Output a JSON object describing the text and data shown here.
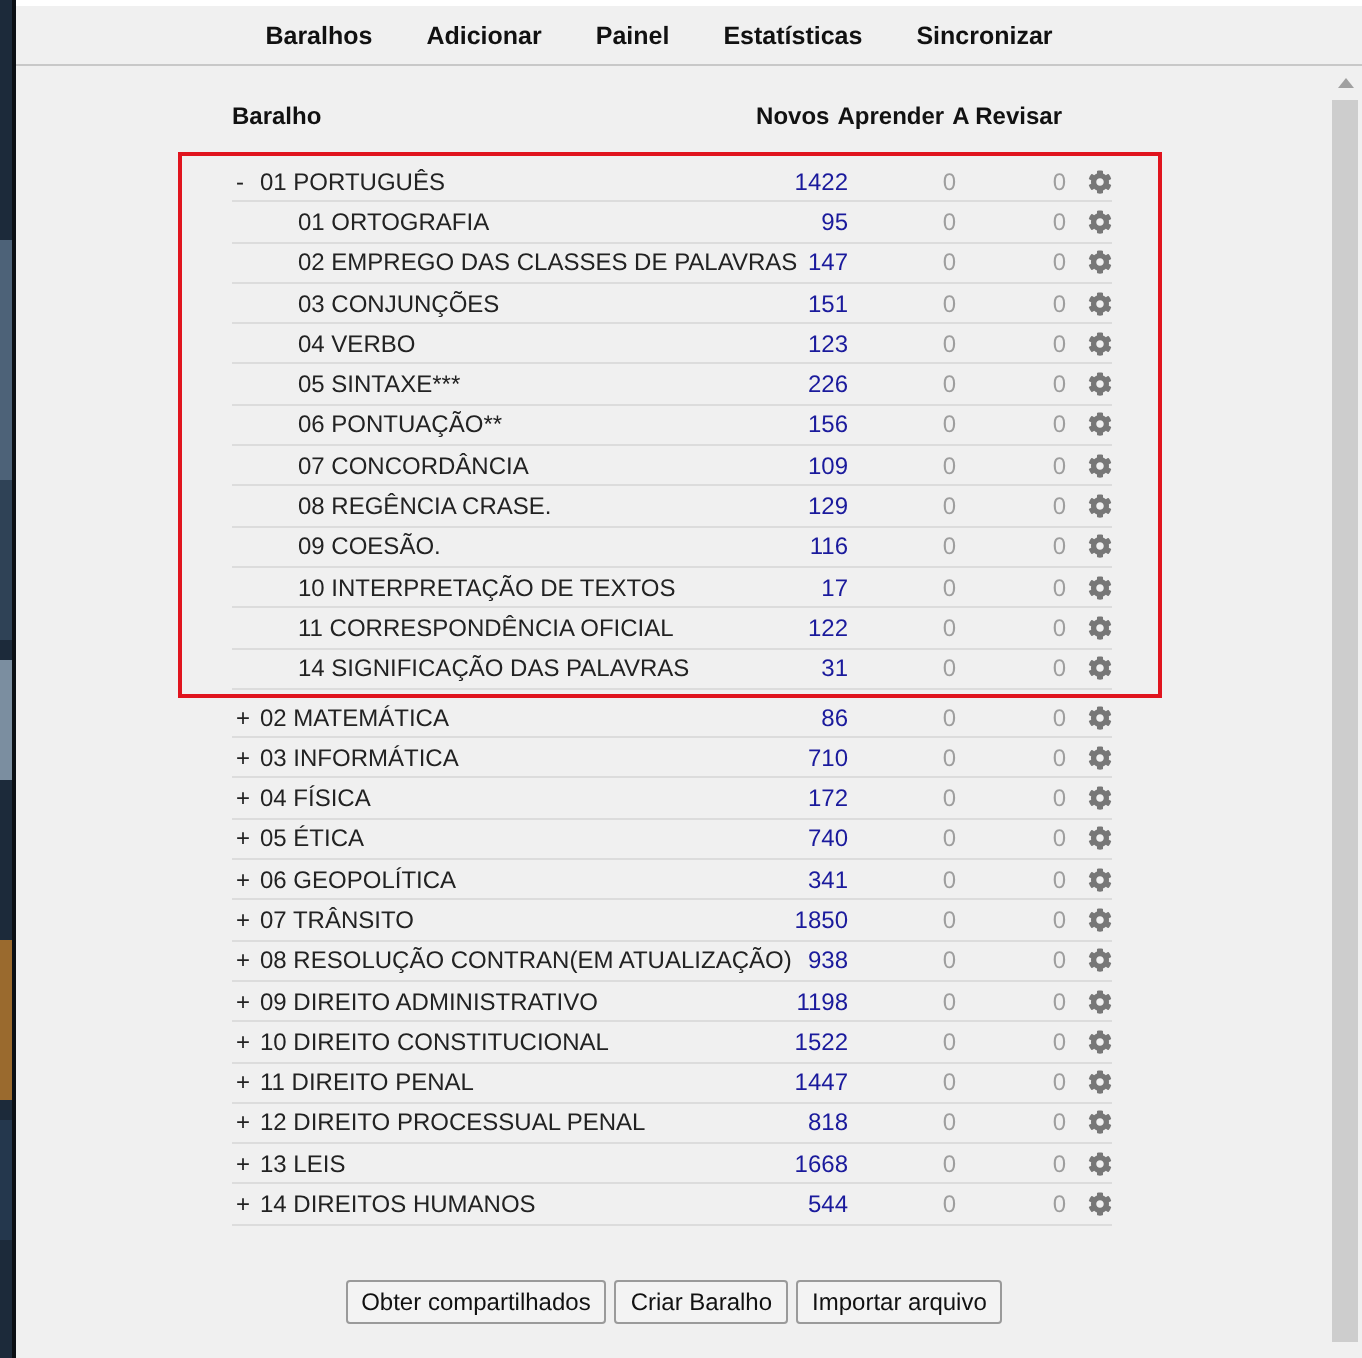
{
  "toolbar": [
    "Baralhos",
    "Adicionar",
    "Painel",
    "Estatísticas",
    "Sincronizar"
  ],
  "columns": {
    "deck": "Baralho",
    "new": "Novos",
    "learn": "Aprender",
    "due": "A Revisar"
  },
  "decks": [
    {
      "toggle": "-",
      "name": "01 PORTUGUÊS",
      "new": "1422",
      "learn": "0",
      "due": "0",
      "highlighted": true,
      "children": [
        {
          "name": "01 ORTOGRAFIA",
          "new": "95",
          "learn": "0",
          "due": "0"
        },
        {
          "name": "02 EMPREGO DAS CLASSES DE PALAVRAS",
          "new": "147",
          "learn": "0",
          "due": "0"
        },
        {
          "name": "03 CONJUNÇÕES",
          "new": "151",
          "learn": "0",
          "due": "0"
        },
        {
          "name": "04 VERBO",
          "new": "123",
          "learn": "0",
          "due": "0"
        },
        {
          "name": "05 SINTAXE***",
          "new": "226",
          "learn": "0",
          "due": "0"
        },
        {
          "name": "06 PONTUAÇÃO**",
          "new": "156",
          "learn": "0",
          "due": "0"
        },
        {
          "name": "07 CONCORDÂNCIA",
          "new": "109",
          "learn": "0",
          "due": "0"
        },
        {
          "name": "08 REGÊNCIA CRASE.",
          "new": "129",
          "learn": "0",
          "due": "0"
        },
        {
          "name": "09 COESÃO.",
          "new": "116",
          "learn": "0",
          "due": "0"
        },
        {
          "name": "10 INTERPRETAÇÃO DE TEXTOS",
          "new": "17",
          "learn": "0",
          "due": "0"
        },
        {
          "name": "11 CORRESPONDÊNCIA OFICIAL",
          "new": "122",
          "learn": "0",
          "due": "0"
        },
        {
          "name": "14 SIGNIFICAÇÃO DAS PALAVRAS",
          "new": "31",
          "learn": "0",
          "due": "0"
        }
      ]
    },
    {
      "toggle": "+",
      "name": "02 MATEMÁTICA",
      "new": "86",
      "learn": "0",
      "due": "0",
      "highlighted": false
    },
    {
      "toggle": "+",
      "name": "03 INFORMÁTICA",
      "new": "710",
      "learn": "0",
      "due": "0",
      "highlighted": false
    },
    {
      "toggle": "+",
      "name": "04 FÍSICA",
      "new": "172",
      "learn": "0",
      "due": "0",
      "highlighted": false
    },
    {
      "toggle": "+",
      "name": "05 ÉTICA",
      "new": "740",
      "learn": "0",
      "due": "0",
      "highlighted": false
    },
    {
      "toggle": "+",
      "name": "06 GEOPOLÍTICA",
      "new": "341",
      "learn": "0",
      "due": "0",
      "highlighted": false
    },
    {
      "toggle": "+",
      "name": "07 TRÂNSITO",
      "new": "1850",
      "learn": "0",
      "due": "0",
      "highlighted": false
    },
    {
      "toggle": "+",
      "name": "08 RESOLUÇÃO CONTRAN(EM ATUALIZAÇÃO)",
      "new": "938",
      "learn": "0",
      "due": "0",
      "highlighted": false
    },
    {
      "toggle": "+",
      "name": "09 DIREITO ADMINISTRATIVO",
      "new": "1198",
      "learn": "0",
      "due": "0",
      "highlighted": false
    },
    {
      "toggle": "+",
      "name": "10 DIREITO CONSTITUCIONAL",
      "new": "1522",
      "learn": "0",
      "due": "0",
      "highlighted": false
    },
    {
      "toggle": "+",
      "name": "11 DIREITO PENAL",
      "new": "1447",
      "learn": "0",
      "due": "0",
      "highlighted": false
    },
    {
      "toggle": "+",
      "name": "12 DIREITO PROCESSUAL PENAL",
      "new": "818",
      "learn": "0",
      "due": "0",
      "highlighted": false
    },
    {
      "toggle": "+",
      "name": "13 LEIS",
      "new": "1668",
      "learn": "0",
      "due": "0",
      "highlighted": false
    },
    {
      "toggle": "+",
      "name": "14 DIREITOS HUMANOS",
      "new": "544",
      "learn": "0",
      "due": "0",
      "highlighted": false
    }
  ],
  "buttons": [
    "Obter compartilhados",
    "Criar Baralho",
    "Importar arquivo"
  ]
}
